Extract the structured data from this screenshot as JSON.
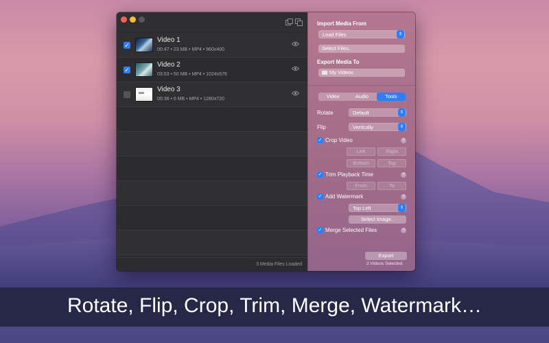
{
  "window": {
    "toolbar_icons": [
      "window-stack-icon",
      "window-duplicate-icon"
    ]
  },
  "media_list": {
    "items": [
      {
        "title": "Video 1",
        "meta": "00:47 • 23 MB • MP4 • 960x400",
        "checked": true,
        "thumb": "video-thumbnail-blue"
      },
      {
        "title": "Video 2",
        "meta": "03:03 • 50 MB • MP4 • 1024x576",
        "checked": true,
        "thumb": "video-thumbnail-teal"
      },
      {
        "title": "Video 3",
        "meta": "00:36 • 6 MB • MP4 • 1280x720",
        "checked": false,
        "thumb": "video-thumbnail-white"
      }
    ],
    "status": "3 Media Files Loaded"
  },
  "sidebar": {
    "import_label": "Import Media From",
    "import_source": "Load Files",
    "select_files": "Select Files..",
    "export_label": "Export Media To",
    "export_dest": "My Videos",
    "tabs": [
      "Video",
      "Audio",
      "Tools"
    ],
    "active_tab": "Tools",
    "rotate_label": "Rotate",
    "rotate_value": "Default",
    "flip_label": "Flip",
    "flip_value": "Vertically",
    "crop_label": "Crop Video",
    "crop_left": "Left",
    "crop_right": "Right",
    "crop_bottom": "Bottom",
    "crop_top": "Top",
    "trim_label": "Trim Playback Time",
    "trim_from": "From",
    "trim_to": "To",
    "watermark_label": "Add Watermark",
    "watermark_position": "Top Left",
    "select_image": "Select Image..",
    "merge_label": "Merge Selected Files",
    "export_button": "Export",
    "selected_status": "2 Videos Selected"
  },
  "banner": {
    "text": "Rotate, Flip, Crop, Trim, Merge, Watermark…"
  },
  "colors": {
    "accent": "#2f7ef5",
    "list_bg": "#2c2c2e",
    "banner_bg": "#262847"
  }
}
